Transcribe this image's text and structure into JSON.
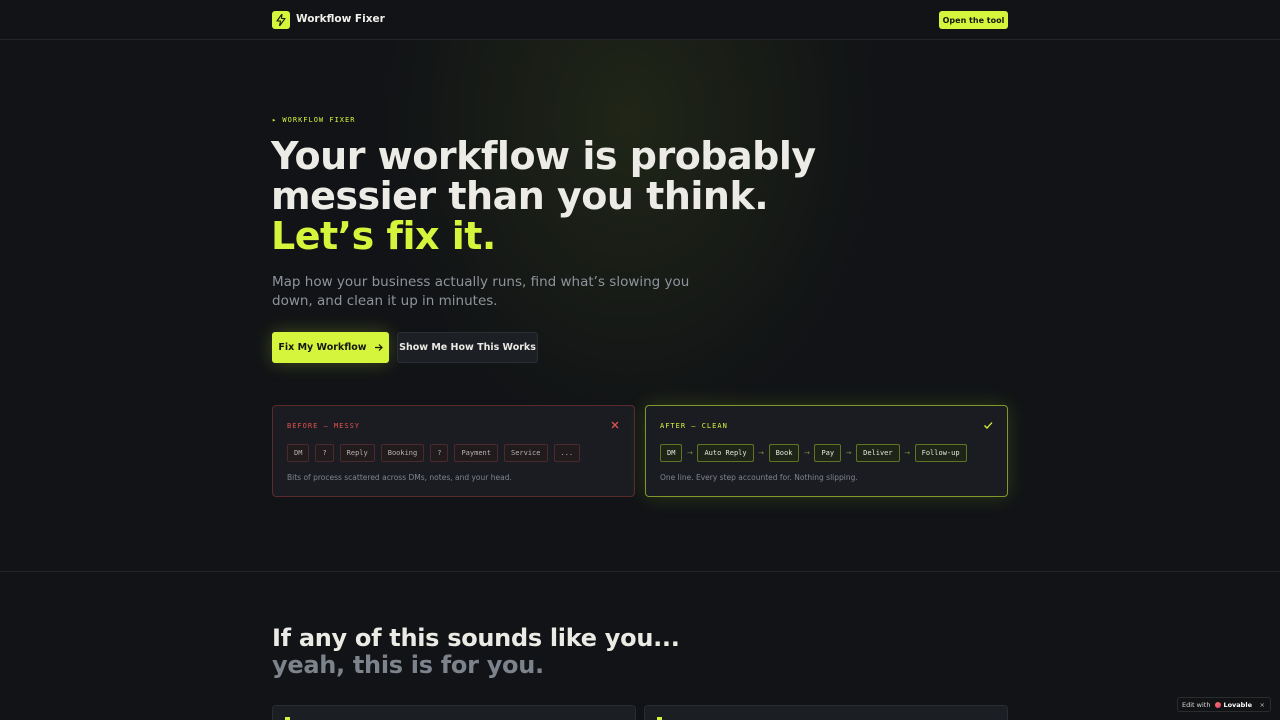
{
  "nav": {
    "brand": "Workflow Fixer",
    "cta_label": "Open the tool"
  },
  "hero": {
    "eyebrow": "▸ WORKFLOW FIXER",
    "title_line1": "Your workflow is probably",
    "title_line2": "messier than you think.",
    "title_accent": "Let’s fix it.",
    "subtitle": "Map how your business actually runs, find what’s slowing you down, and clean it up in minutes.",
    "primary_button": "Fix My Workflow",
    "secondary_button": "Show Me How This Works"
  },
  "before_card": {
    "label": "BEFORE — MESSY",
    "chips": [
      "DM",
      "?",
      "Reply",
      "Booking",
      "?",
      "Payment",
      "Service",
      "..."
    ],
    "description": "Bits of process scattered across DMs, notes, and your head.",
    "icon": "close-icon"
  },
  "after_card": {
    "label": "AFTER — CLEAN",
    "chips": [
      "DM",
      "Auto Reply",
      "Book",
      "Pay",
      "Deliver",
      "Follow-up"
    ],
    "arrow": "→",
    "description": "One line. Every step accounted for. Nothing slipping.",
    "icon": "check-icon"
  },
  "section2": {
    "heading_main": "If any of this sounds like you...",
    "heading_muted": " yeah, this is for you."
  },
  "badge": {
    "prefix": "Edit with",
    "brand": "Lovable",
    "close": "×"
  },
  "colors": {
    "accent": "#d4f53c",
    "background": "#111316",
    "danger": "#e0524d",
    "muted_text": "#8f949c"
  }
}
